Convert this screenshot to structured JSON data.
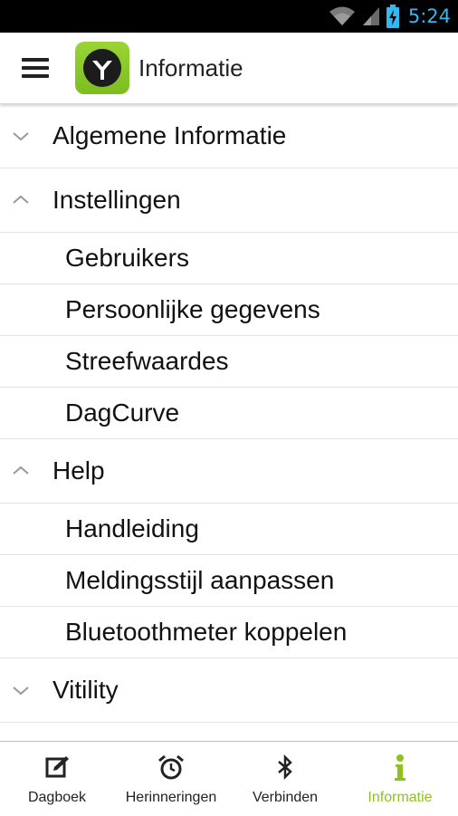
{
  "status_bar": {
    "time": "5:24",
    "icons": [
      "wifi-icon",
      "signal-icon",
      "battery-charging-icon"
    ]
  },
  "app_bar": {
    "title": "Informatie",
    "menu_icon": "hamburger-menu-icon",
    "logo_icon": "vitility-logo-icon"
  },
  "sections": [
    {
      "label": "Algemene Informatie",
      "expanded": false,
      "items": []
    },
    {
      "label": "Instellingen",
      "expanded": true,
      "items": [
        "Gebruikers",
        "Persoonlijke gegevens",
        "Streefwaardes",
        "DagCurve"
      ]
    },
    {
      "label": "Help",
      "expanded": true,
      "items": [
        "Handleiding",
        "Meldingsstijl aanpassen",
        "Bluetoothmeter koppelen"
      ]
    },
    {
      "label": "Vitility",
      "expanded": false,
      "items": []
    }
  ],
  "bottom_nav": [
    {
      "label": "Dagboek",
      "icon": "edit-icon",
      "active": false
    },
    {
      "label": "Herinneringen",
      "icon": "alarm-clock-icon",
      "active": false
    },
    {
      "label": "Verbinden",
      "icon": "bluetooth-icon",
      "active": false
    },
    {
      "label": "Informatie",
      "icon": "info-icon",
      "active": true
    }
  ],
  "colors": {
    "accent": "#8dc21f",
    "status_text": "#35b7f0",
    "status_bg": "#000000"
  }
}
